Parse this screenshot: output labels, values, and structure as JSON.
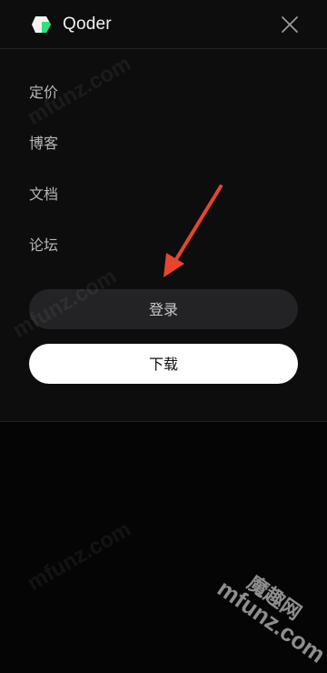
{
  "header": {
    "brand": "Qoder",
    "logo_icon": "qoder-logo-icon",
    "close_icon": "close-icon"
  },
  "nav": {
    "items": [
      {
        "label": "定价"
      },
      {
        "label": "博客"
      },
      {
        "label": "文档"
      },
      {
        "label": "论坛"
      }
    ]
  },
  "actions": {
    "login_label": "登录",
    "download_label": "下载"
  },
  "watermark": {
    "text": "mfunz.com",
    "cn_text": "魔趣网"
  },
  "colors": {
    "background": "#050505",
    "panel": "#0d0d0e",
    "logo_accent": "#2fe07e",
    "login_bg": "#232325",
    "download_bg": "#ffffff",
    "arrow": "#e8452f"
  }
}
